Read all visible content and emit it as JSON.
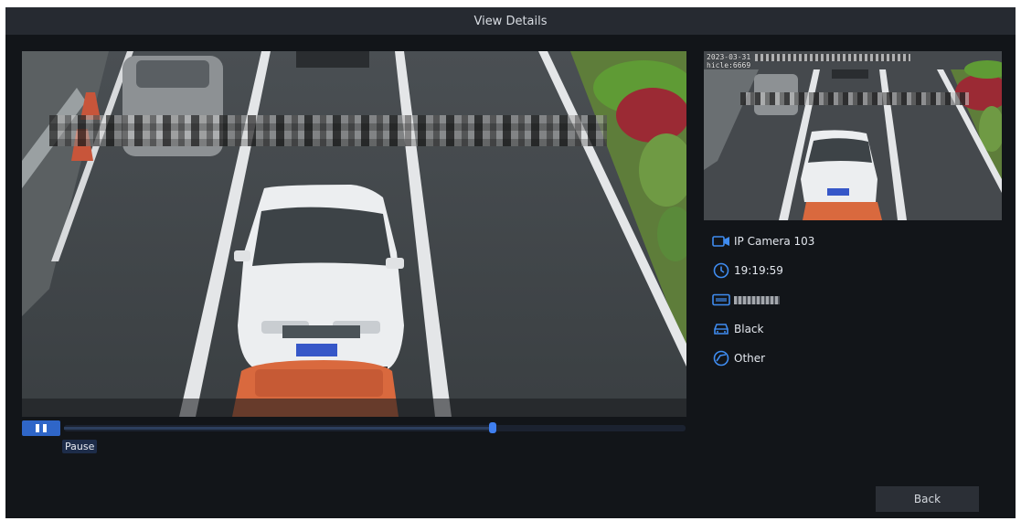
{
  "dialog": {
    "title": "View Details"
  },
  "player": {
    "pause_label": "Pause",
    "progress": 0.69
  },
  "details": {
    "camera": "IP Camera 103",
    "time": "19:19:59",
    "vehicle_color": "Black",
    "vehicle_type": "Other"
  },
  "snapshot": {
    "osd_date": "2023-03-31",
    "osd_tail": "hicle:6669"
  },
  "footer": {
    "back_label": "Back"
  },
  "icons": {
    "camera": "camera-icon",
    "time": "clock-icon",
    "plate": "plate-icon",
    "color": "car-icon",
    "type": "vehicle-type-icon",
    "pause": "pause-icon"
  },
  "colors": {
    "accent": "#2f66c8",
    "icon": "#3f8cf0",
    "background": "#121519"
  }
}
